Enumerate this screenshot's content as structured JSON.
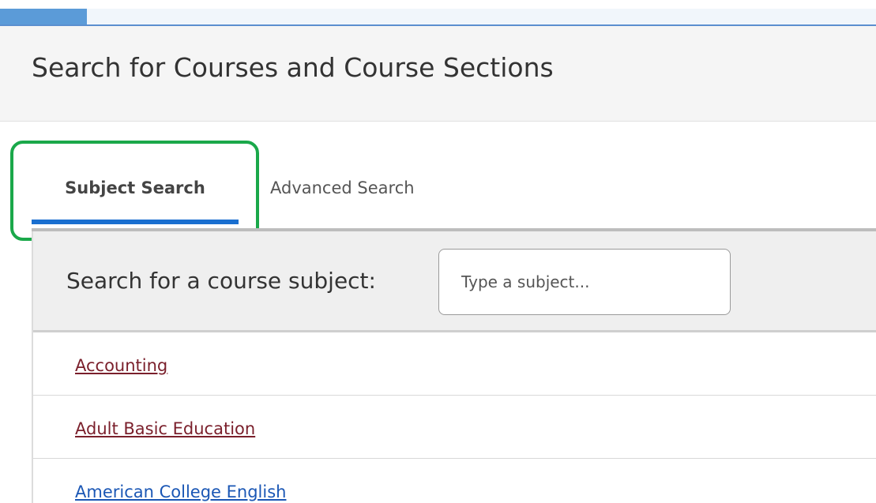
{
  "header": {
    "title": "Search for Courses and Course Sections"
  },
  "tabs": [
    {
      "label": "Subject Search",
      "active": true
    },
    {
      "label": "Advanced Search",
      "active": false
    }
  ],
  "subject_search": {
    "label": "Search for a course subject:",
    "placeholder": "Type a subject...",
    "value": ""
  },
  "subjects": [
    {
      "label": "Accounting",
      "color": "#7a1f2b"
    },
    {
      "label": "Adult Basic Education",
      "color": "#7a1f2b"
    },
    {
      "label": "American College English",
      "color": "#1b57b5"
    }
  ],
  "colors": {
    "accent": "#1a6fd0",
    "highlight": "#1aa84a",
    "visited_link": "#7a1f2b",
    "link": "#1b57b5"
  }
}
